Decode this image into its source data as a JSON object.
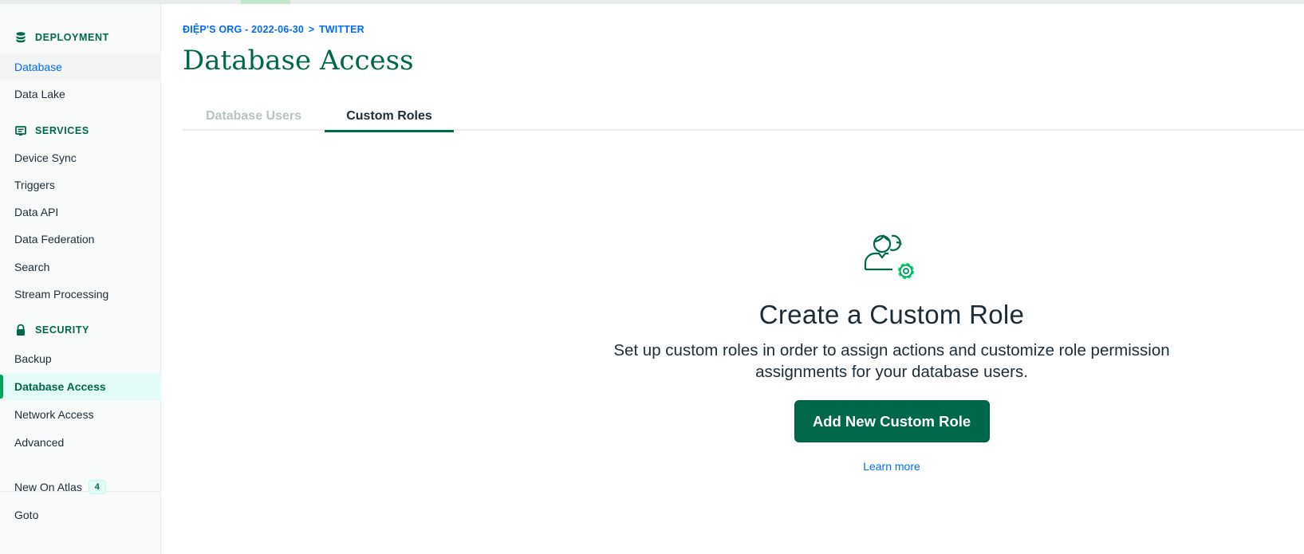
{
  "sidebar": {
    "deployment": {
      "heading": "DEPLOYMENT",
      "icon": "database-icon",
      "items": [
        {
          "label": "Database"
        },
        {
          "label": "Data Lake"
        }
      ]
    },
    "services": {
      "heading": "SERVICES",
      "icon": "services-icon",
      "items": [
        {
          "label": "Device Sync"
        },
        {
          "label": "Triggers"
        },
        {
          "label": "Data API"
        },
        {
          "label": "Data Federation"
        },
        {
          "label": "Search"
        },
        {
          "label": "Stream Processing"
        }
      ]
    },
    "security": {
      "heading": "SECURITY",
      "icon": "lock-icon",
      "items": [
        {
          "label": "Backup"
        },
        {
          "label": "Database Access"
        },
        {
          "label": "Network Access"
        },
        {
          "label": "Advanced"
        }
      ]
    },
    "footer": {
      "new_on_atlas": "New On Atlas",
      "new_count": "4",
      "goto": "Goto"
    }
  },
  "breadcrumb": {
    "org": "ĐIỆP'S ORG - 2022-06-30",
    "separator": ">",
    "project": "TWITTER"
  },
  "page": {
    "title": "Database Access"
  },
  "tabs": [
    {
      "label": "Database Users",
      "active": false
    },
    {
      "label": "Custom Roles",
      "active": true
    }
  ],
  "empty_state": {
    "icon": "user-gear-icon",
    "title": "Create a Custom Role",
    "description": "Set up custom roles in order to assign actions and customize role permission assignments for your database users.",
    "button_label": "Add New Custom Role",
    "link_label": "Learn more"
  },
  "colors": {
    "brand_green": "#00684a",
    "accent_green": "#00a35c",
    "link_blue": "#016bf8"
  }
}
